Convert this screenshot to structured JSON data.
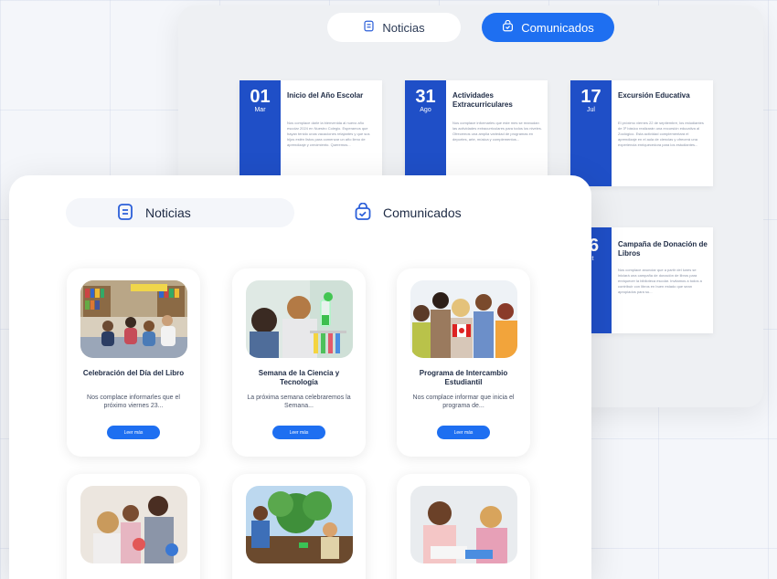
{
  "back_tabs": {
    "noticias": "Noticias",
    "comunicados": "Comunicados"
  },
  "comunicados": [
    {
      "day": "01",
      "month": "Mar",
      "title": "Inicio del Año Escolar",
      "text": "Nos complace darle la bienvenida al nuevo año escolar 2024 en Nuestro Colegio. Esperamos que hayan tenido unas vacaciones relajantes y que sus hijos estén listos para comenzar un año lleno de aprendizaje y crecimiento. Queremos..."
    },
    {
      "day": "31",
      "month": "Ago",
      "title": "Actividades Extracurriculares",
      "text": "Nos complace informarles que este mes se reanudan las actividades extracurriculares para todos los niveles. Ofrecemos una amplia variedad de programas en deportes, arte, música y complementos..."
    },
    {
      "day": "17",
      "month": "Jul",
      "title": "Excursión Educativa",
      "text": "El próximo viernes 22 de septiembre, los estudiantes de 3º básico realizarán una excursión educativa al Zoológico. Esta actividad complementará el aprendizaje en el aula de ciencias y ofrecerá una experiencia enriquecedora para los estudiantes..."
    },
    {
      "day": "6",
      "month": "ct",
      "title": "Campaña de Donación de Libros",
      "text": "Nos complace anunciar que a partir del lunes se iniciará una campaña de donación de libros para enriquecer la biblioteca escolar. Invitamos a todos a contribuir con libros en buen estado que sean apropiados para su..."
    }
  ],
  "front_tabs": {
    "noticias": "Noticias",
    "comunicados": "Comunicados"
  },
  "news": [
    {
      "title": "Celebración del Día del Libro",
      "text": "Nos complace informarles que el próximo viernes 23...",
      "button": "Leer más"
    },
    {
      "title": "Semana de la Ciencia y Tecnología",
      "text": "La próxima semana celebraremos la Semana...",
      "button": "Leer más"
    },
    {
      "title": "Programa de Intercambio Estudiantil",
      "text": "Nos complace informar que inicia el programa de...",
      "button": "Leer más"
    }
  ],
  "colors": {
    "accent": "#1e6ff1",
    "date_block": "#1f4fc7",
    "text_dark": "#1d2a44"
  }
}
